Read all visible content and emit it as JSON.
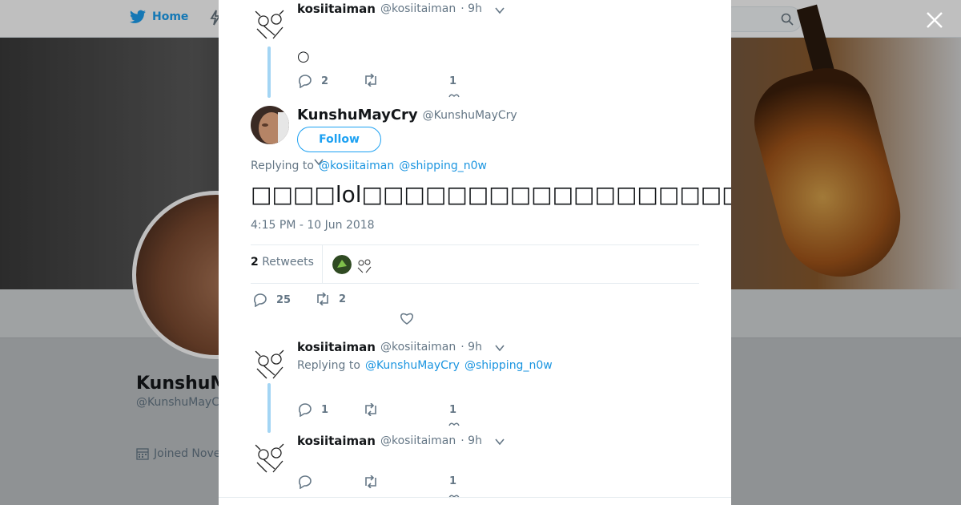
{
  "topnav": {
    "home_label": "Home"
  },
  "profile": {
    "name_partial": "KunshuM",
    "handle_partial": "@KunshuMayC",
    "joined_partial": "Joined Nove"
  },
  "modal": {
    "tweet1": {
      "name": "kosiitaiman",
      "handle": "@kosiitaiman",
      "time": "· 9h",
      "text": "○",
      "replies": "2",
      "retweets": "",
      "likes": "1"
    },
    "main": {
      "name": "KunshuMayCry",
      "handle": "@KunshuMayCry",
      "follow_label": "Follow",
      "replying_prefix": "Replying to",
      "replying_users": [
        "@kosiitaiman",
        "@shipping_n0w"
      ],
      "text": "□□□□lol□□□□□□□□□□□□□□□□□□□□□□□😭",
      "timestamp": "4:15 PM - 10 Jun 2018",
      "retweet_count": "2",
      "retweet_label": "Retweets",
      "replies": "25",
      "retweets": "2"
    },
    "tweet2": {
      "name": "kosiitaiman",
      "handle": "@kosiitaiman",
      "time": "· 9h",
      "replying_prefix": "Replying to",
      "replying_users": [
        "@KunshuMayCry",
        "@shipping_n0w"
      ],
      "replies": "1",
      "likes": "1"
    },
    "tweet3": {
      "name": "kosiitaiman",
      "handle": "@kosiitaiman",
      "time": "· 9h",
      "likes": "1"
    }
  },
  "colors": {
    "accent": "#1da1f2",
    "link": "#1b95e0",
    "thread": "#a3d5f4"
  }
}
